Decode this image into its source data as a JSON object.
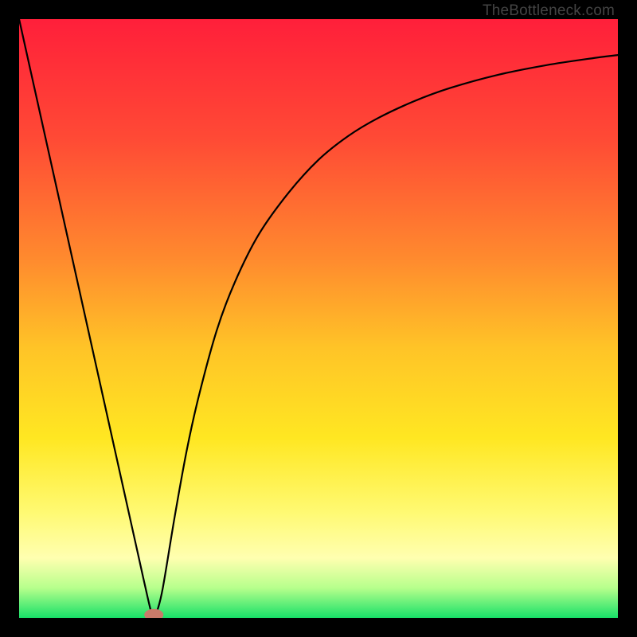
{
  "watermark": "TheBottleneck.com",
  "chart_data": {
    "type": "line",
    "title": "",
    "xlabel": "",
    "ylabel": "",
    "xlim": [
      0,
      100
    ],
    "ylim": [
      0,
      100
    ],
    "grid": false,
    "legend": false,
    "background_gradient": {
      "stops": [
        {
          "pos": 0.0,
          "color": "#ff1f3a"
        },
        {
          "pos": 0.2,
          "color": "#ff4a35"
        },
        {
          "pos": 0.4,
          "color": "#ff8a2e"
        },
        {
          "pos": 0.55,
          "color": "#ffc427"
        },
        {
          "pos": 0.7,
          "color": "#ffe722"
        },
        {
          "pos": 0.82,
          "color": "#fff970"
        },
        {
          "pos": 0.9,
          "color": "#ffffb0"
        },
        {
          "pos": 0.95,
          "color": "#b7ff8c"
        },
        {
          "pos": 1.0,
          "color": "#18e068"
        }
      ]
    },
    "series": [
      {
        "name": "curve",
        "color": "#000000",
        "x": [
          0.0,
          2,
          4,
          6,
          8,
          10,
          12,
          14,
          16,
          18,
          20,
          21,
          22,
          22.5,
          23,
          24,
          26,
          28,
          30,
          33,
          36,
          40,
          45,
          50,
          55,
          60,
          66,
          72,
          80,
          88,
          96,
          100
        ],
        "y": [
          100,
          91,
          82,
          73,
          64,
          55,
          46,
          37,
          28,
          19,
          10,
          5.5,
          1.2,
          0.2,
          1.0,
          5.0,
          17,
          28,
          37,
          48,
          56,
          64,
          71,
          76.5,
          80.5,
          83.5,
          86.3,
          88.5,
          90.7,
          92.3,
          93.5,
          94
        ]
      }
    ],
    "marker": {
      "x": 22.5,
      "y": 0.5,
      "color": "#c97b6a",
      "rx": 1.6,
      "ry": 1.0
    }
  }
}
